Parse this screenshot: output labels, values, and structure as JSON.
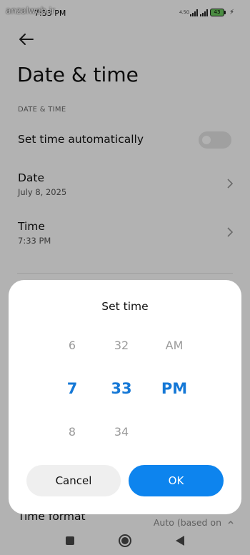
{
  "status_bar": {
    "time": "7:33 PM",
    "watermark": "anzalweb.ir",
    "network_label": "4.5G",
    "battery": "43"
  },
  "page": {
    "title": "Date & time",
    "section": "DATE & TIME",
    "auto_time": {
      "label": "Set time automatically",
      "enabled": false
    },
    "date": {
      "label": "Date",
      "value": "July 8, 2025"
    },
    "time": {
      "label": "Time",
      "value": "7:33 PM"
    },
    "time_format": {
      "label": "Time format",
      "value": "Auto (based on"
    }
  },
  "dialog": {
    "title": "Set time",
    "hour": {
      "prev": "6",
      "selected": "7",
      "next": "8"
    },
    "minute": {
      "prev": "32",
      "selected": "33",
      "next": "34"
    },
    "period": {
      "prev": "AM",
      "selected": "PM"
    },
    "cancel_label": "Cancel",
    "ok_label": "OK"
  },
  "colors": {
    "accent": "#1578d6",
    "ok_button": "#0d84ee",
    "cancel_button": "#efefef",
    "scrim": "#000000"
  },
  "icons": {
    "back": "back-arrow-icon",
    "chevron": "chevron-right-icon",
    "nav_recents": "square-icon",
    "nav_home": "circle-icon",
    "nav_back": "triangle-back-icon"
  }
}
